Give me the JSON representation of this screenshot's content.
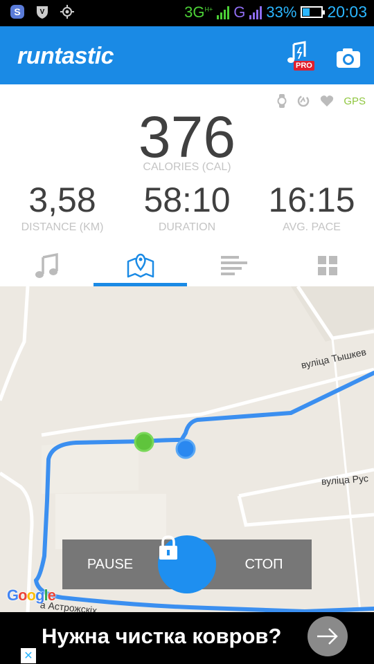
{
  "status_bar": {
    "network_3g": "3G",
    "network_3g_sup": "H+",
    "network_g": "G",
    "battery_pct": "33%",
    "battery_level": 0.33,
    "time": "20:03",
    "icons": [
      "s-app-icon",
      "shield-icon",
      "crosshair-icon"
    ]
  },
  "app_bar": {
    "logo": "runtastic",
    "pro_badge": "PRO",
    "brand_color": "#1a8ae5"
  },
  "sensors": {
    "icons": [
      "watch-icon",
      "cadence-icon",
      "heart-icon"
    ],
    "gps_label": "GPS",
    "gps_color": "#8fc63e"
  },
  "stats": {
    "main": {
      "value": "376",
      "label": "CALORIES (CAL)"
    },
    "distance": {
      "value": "3,58",
      "label": "DISTANCE (KM)"
    },
    "duration": {
      "value": "58:10",
      "label": "DURATION"
    },
    "pace": {
      "value": "16:15",
      "label": "AVG. PACE"
    }
  },
  "tabs": [
    {
      "icon": "music-note-icon",
      "active": false
    },
    {
      "icon": "map-pin-icon",
      "active": true
    },
    {
      "icon": "bar-list-icon",
      "active": false
    },
    {
      "icon": "grid-icon",
      "active": false
    }
  ],
  "map": {
    "streets": [
      "вуліца Тышкев",
      "вуліца Рус",
      "а Астрожскіх"
    ],
    "attribution": "Google",
    "route_color": "#3b8ff0"
  },
  "controls": {
    "pause": "PAUSE",
    "stop": "СТОП"
  },
  "ad": {
    "text": "Нужна чистка ковров?",
    "close_glyph": "✕"
  }
}
